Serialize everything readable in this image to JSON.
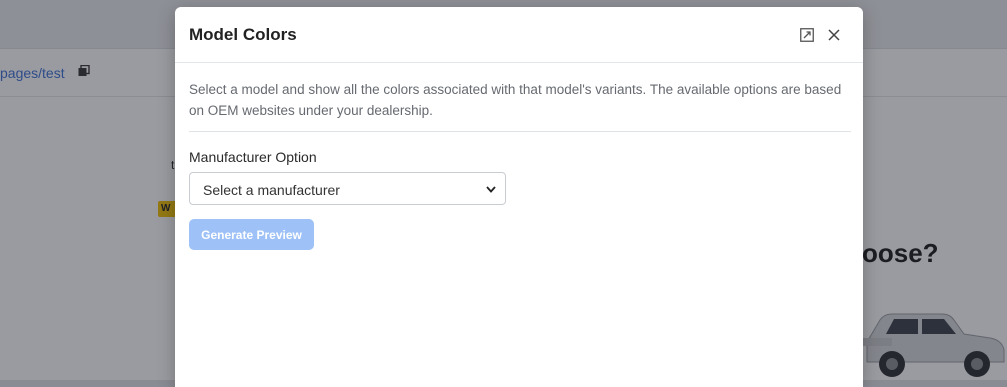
{
  "background": {
    "path_text": "pages/test",
    "badge_text": "W",
    "stray_text": "t",
    "heading_fragment": "oose?"
  },
  "modal": {
    "title": "Model Colors",
    "description": "Select a model and show all the colors associated with that model's variants. The available options are based on OEM websites under your dealership.",
    "manufacturer_label": "Manufacturer Option",
    "manufacturer_select": {
      "selected": "Select a manufacturer"
    },
    "generate_button": "Generate Preview"
  },
  "icons": {
    "expand": "expand-icon",
    "close": "close-icon",
    "copy": "copy-icon",
    "chevron": "chevron-down-icon"
  },
  "colors": {
    "accent_disabled": "#9ec1f7",
    "link": "#3b6fd8",
    "warning": "#f2c200"
  }
}
